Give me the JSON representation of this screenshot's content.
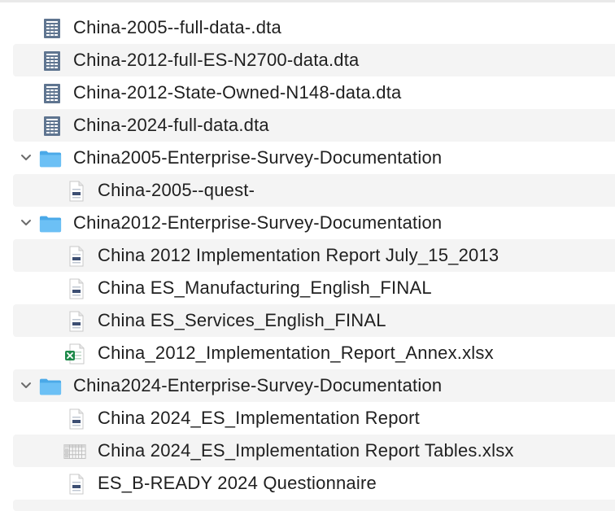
{
  "items": [
    {
      "label": "China-2005--full-data-.dta",
      "icon": "spreadsheet-doc-icon"
    },
    {
      "label": "China-2012-full-ES-N2700-data.dta",
      "icon": "spreadsheet-doc-icon"
    },
    {
      "label": "China-2012-State-Owned-N148-data.dta",
      "icon": "spreadsheet-doc-icon"
    },
    {
      "label": "China-2024-full-data.dta",
      "icon": "spreadsheet-doc-icon"
    },
    {
      "label": "China2005-Enterprise-Survey-Documentation",
      "icon": "folder-icon",
      "expanded": true
    },
    {
      "label": "China-2005--quest-",
      "icon": "pdf-doc-icon"
    },
    {
      "label": "China2012-Enterprise-Survey-Documentation",
      "icon": "folder-icon",
      "expanded": true
    },
    {
      "label": "China 2012 Implementation Report July_15_2013",
      "icon": "pdf-doc-icon"
    },
    {
      "label": "China ES_Manufacturing_English_FINAL",
      "icon": "pdf-doc-icon"
    },
    {
      "label": "China ES_Services_English_FINAL",
      "icon": "pdf-doc-icon"
    },
    {
      "label": "China_2012_Implementation_Report_Annex.xlsx",
      "icon": "excel-file-icon"
    },
    {
      "label": "China2024-Enterprise-Survey-Documentation",
      "icon": "folder-icon",
      "expanded": true
    },
    {
      "label": "China 2024_ES_Implementation Report",
      "icon": "pdf-doc-icon"
    },
    {
      "label": "China 2024_ES_Implementation Report Tables.xlsx",
      "icon": "table-file-icon"
    },
    {
      "label": "ES_B-READY 2024 Questionnaire",
      "icon": "pdf-doc-icon"
    }
  ]
}
